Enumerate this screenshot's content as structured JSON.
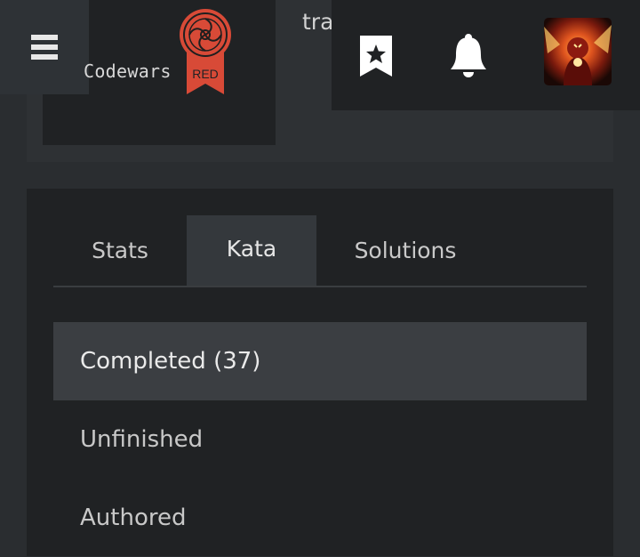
{
  "header": {
    "brand_text": "Codewars",
    "rank_label": "RED",
    "partial_title": "tra"
  },
  "icons": {
    "menu": "hamburger-menu-icon",
    "logo": "codewars-rank-badge",
    "bookmark": "bookmark-star-icon",
    "notifications": "bell-icon",
    "avatar": "user-avatar"
  },
  "colors": {
    "rank_red": "#d84a37",
    "background": "#2a2d30",
    "panel": "#202224",
    "active_tab": "#34383c",
    "active_item": "#3b3e42"
  },
  "tabs": [
    {
      "label": "Stats",
      "active": false
    },
    {
      "label": "Kata",
      "active": true
    },
    {
      "label": "Solutions",
      "active": false
    }
  ],
  "kata_list": [
    {
      "label": "Completed (37)",
      "active": true
    },
    {
      "label": "Unfinished",
      "active": false
    },
    {
      "label": "Authored",
      "active": false
    }
  ]
}
